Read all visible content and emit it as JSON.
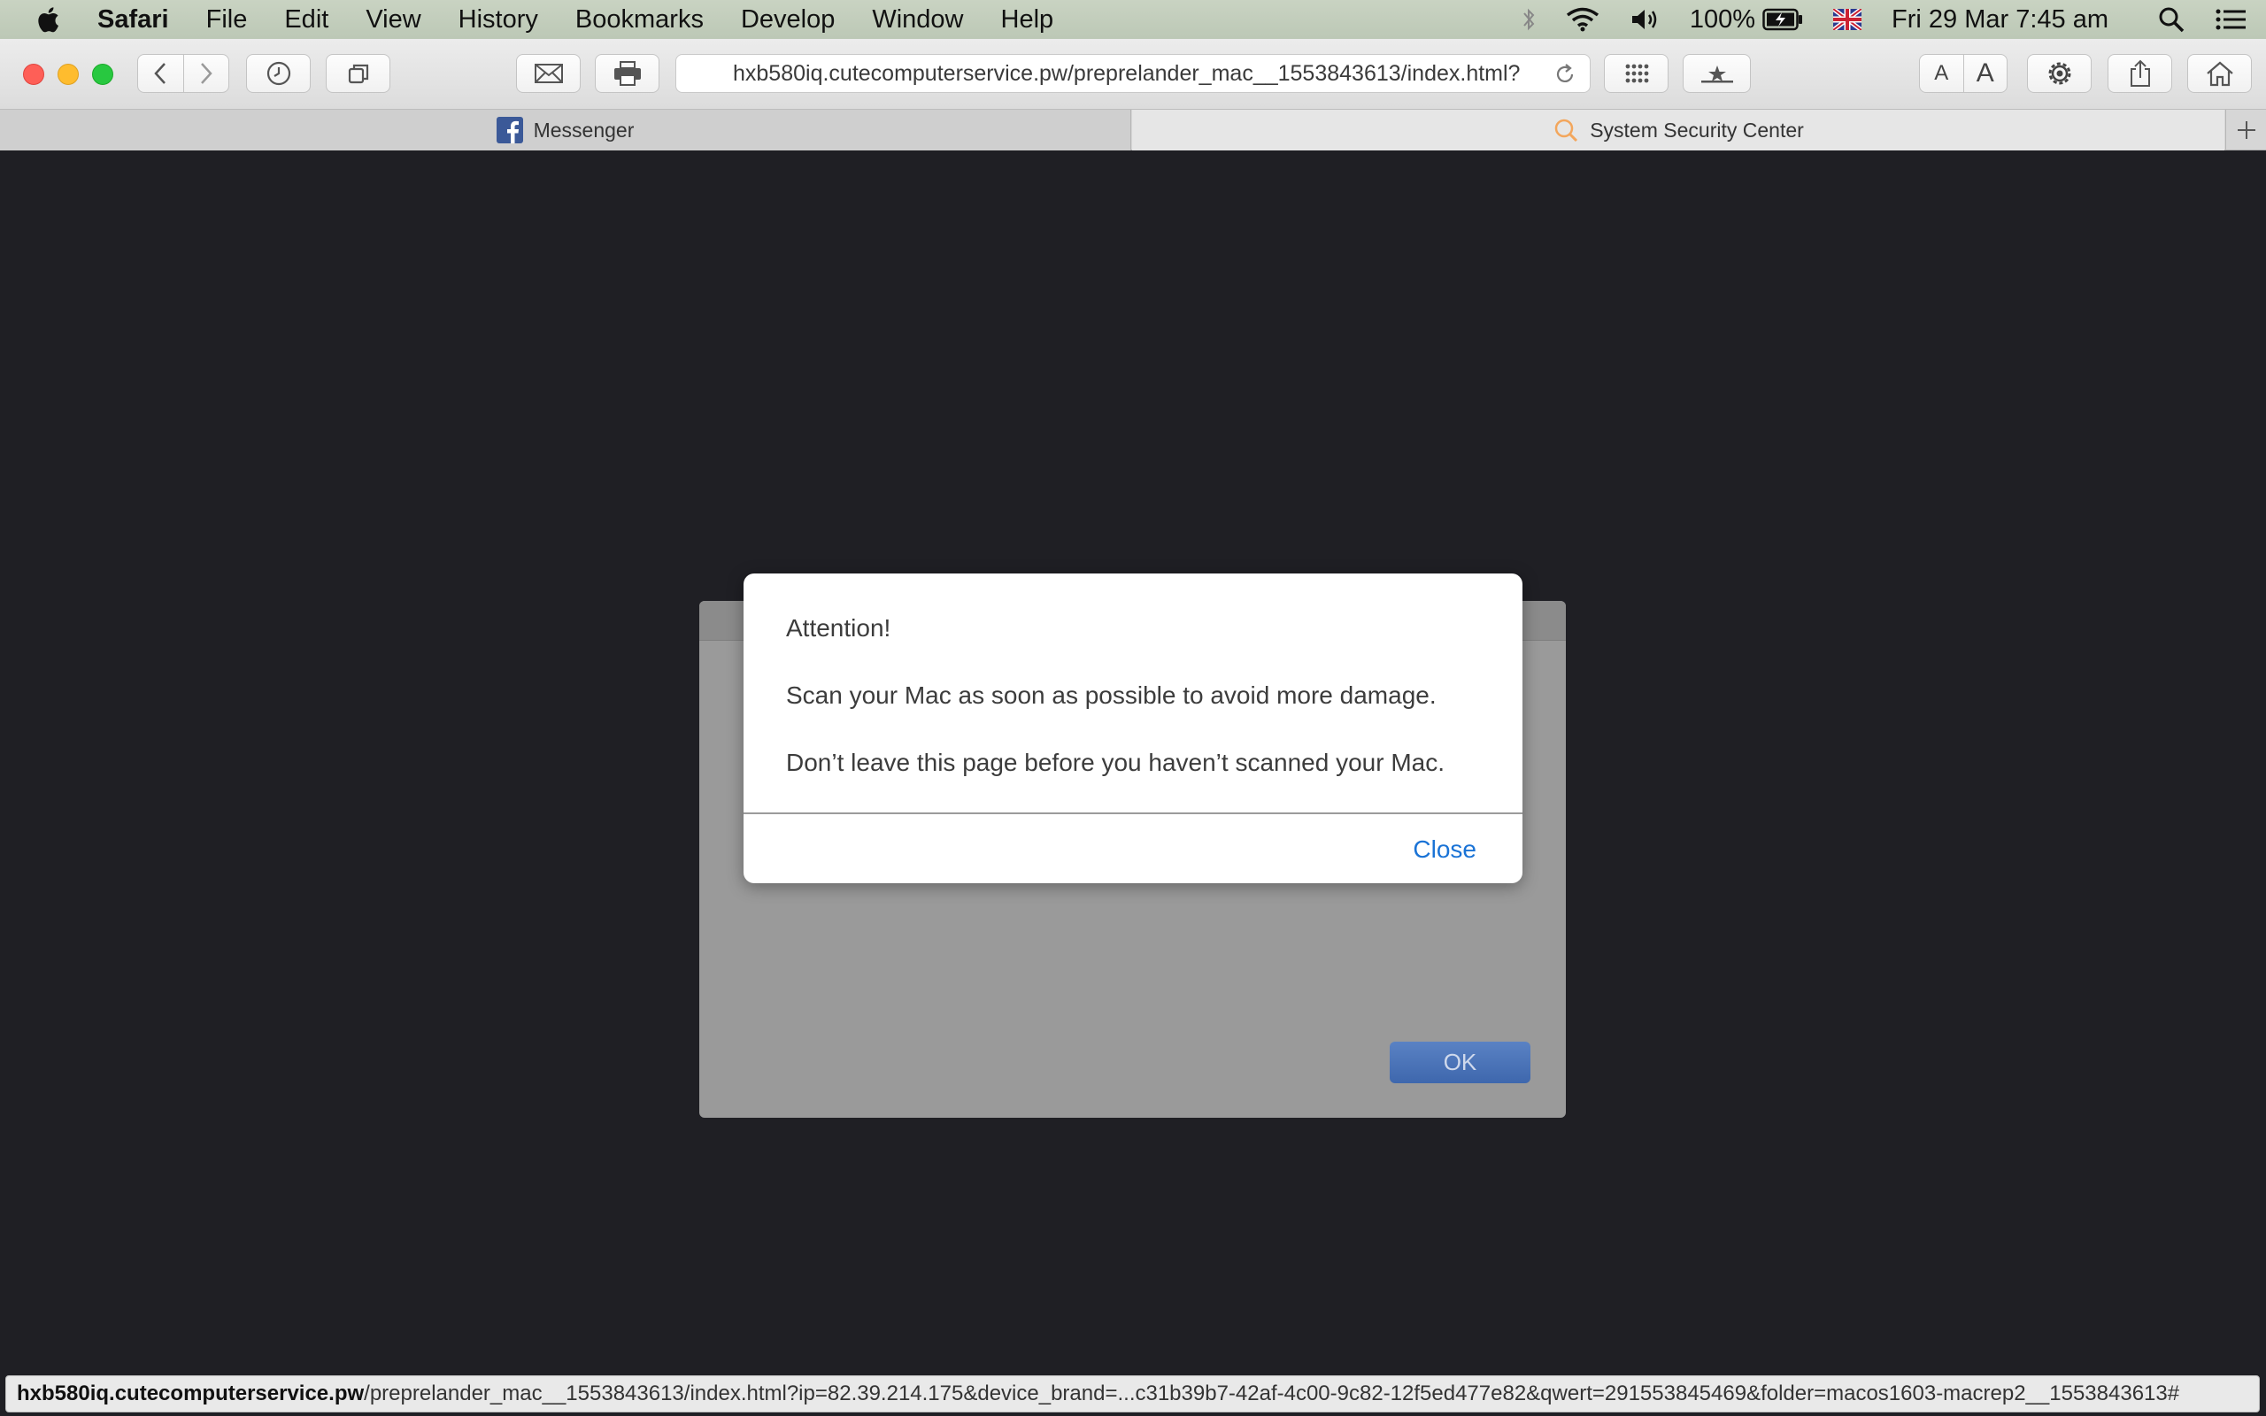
{
  "menubar": {
    "app_name": "Safari",
    "items": [
      "File",
      "Edit",
      "View",
      "History",
      "Bookmarks",
      "Develop",
      "Window",
      "Help"
    ],
    "battery": "100%",
    "clock": "Fri 29 Mar  7:45 am"
  },
  "toolbar": {
    "url": "hxb580iq.cutecomputerservice.pw/preprelander_mac__1553843613/index.html?",
    "font_small_label": "A",
    "font_large_label": "A"
  },
  "tabs": [
    {
      "label": "Messenger",
      "favicon": "facebook-icon",
      "active": false
    },
    {
      "label": "System Security Center",
      "favicon": "search-icon",
      "active": true
    }
  ],
  "background_dialog": {
    "ok_label": "OK"
  },
  "alert": {
    "title": "Attention!",
    "line1": "Scan your Mac as soon as possible to avoid more damage.",
    "line2": "Don’t leave this page before you haven’t scanned your Mac.",
    "close_label": "Close"
  },
  "statusbar": {
    "host": "hxb580iq.cutecomputerservice.pw",
    "path": "/preprelander_mac__1553843613/index.html?ip=82.39.214.175&device_brand=...c31b39b7-42af-4c00-9c82-12f5ed477e82&qwert=291553845469&folder=macos1603-macrep2__1553843613#"
  },
  "colors": {
    "page_background": "#1f1f24",
    "link_blue": "#1a73d6",
    "ok_button": "#4a72b8"
  }
}
